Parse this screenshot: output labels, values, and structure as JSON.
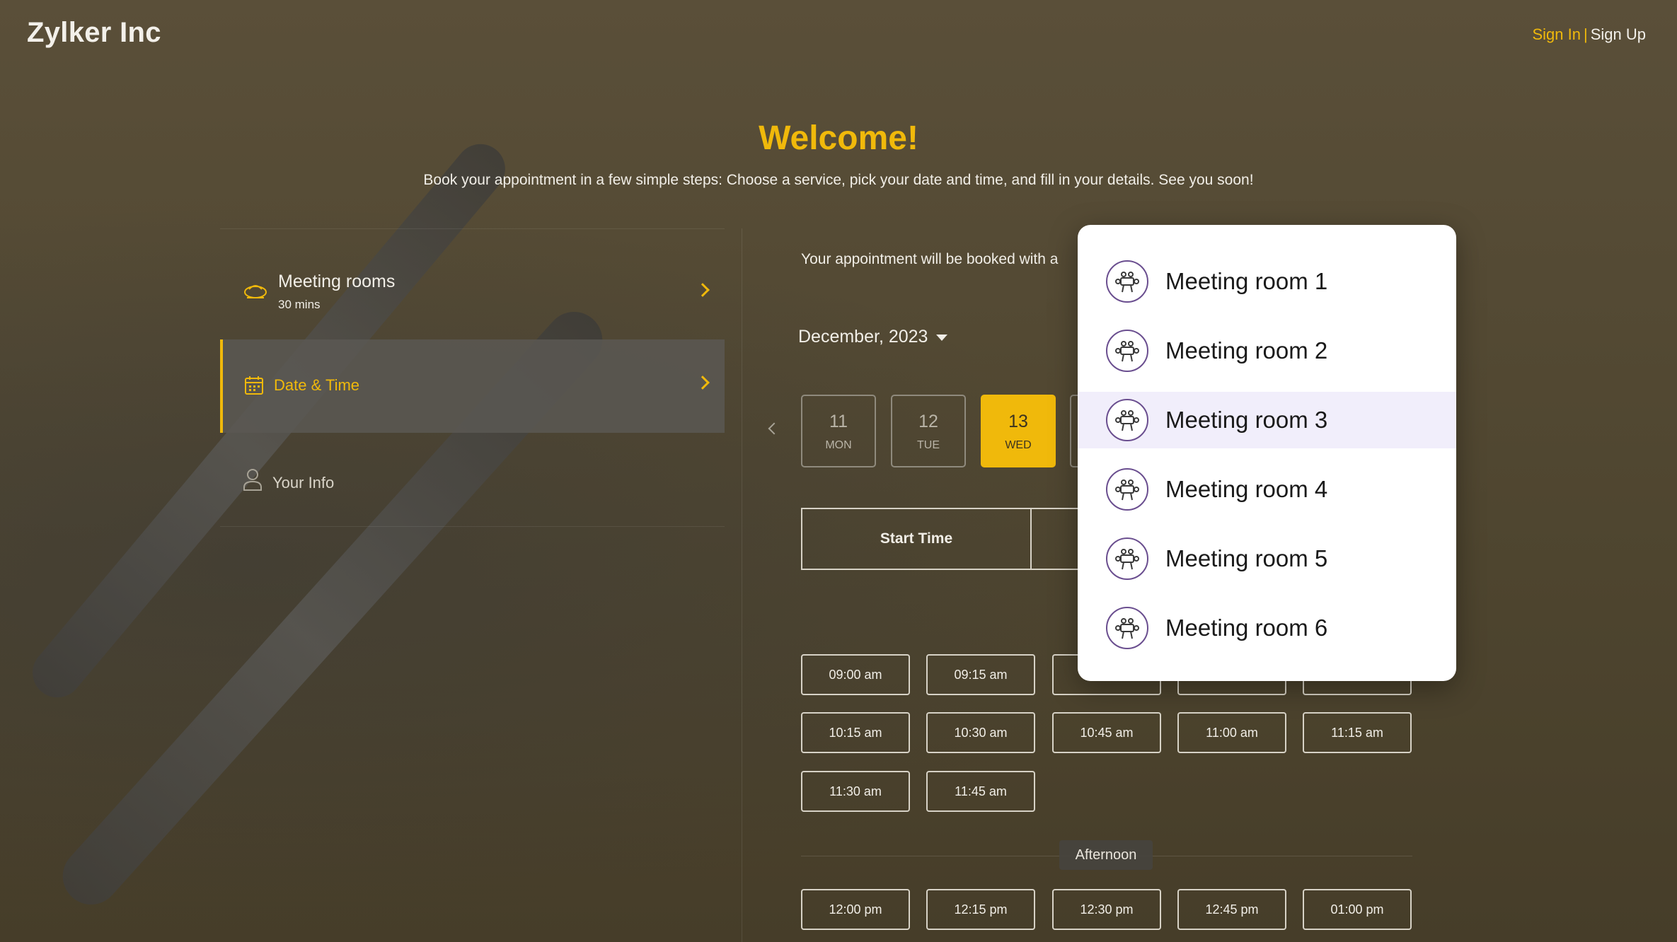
{
  "header": {
    "brand": "Zylker Inc",
    "sign_in": "Sign In",
    "separator": "|",
    "sign_up": "Sign Up"
  },
  "hero": {
    "title": "Welcome!",
    "subtitle": "Book your appointment in a few simple steps: Choose a service, pick your date and time, and fill in your details. See you soon!"
  },
  "steps": [
    {
      "title": "Meeting rooms",
      "sub": "30 mins",
      "icon": "meeting-room-icon"
    },
    {
      "title": "Date & Time",
      "icon": "calendar-icon",
      "active": true
    },
    {
      "title": "Your Info",
      "icon": "user-icon"
    }
  ],
  "booking": {
    "notice": "Your appointment will be booked with a",
    "month": "December, 2023",
    "days": [
      {
        "num": "11",
        "dow": "MON"
      },
      {
        "num": "12",
        "dow": "TUE"
      },
      {
        "num": "13",
        "dow": "WED",
        "selected": true
      }
    ],
    "start_time_label": "Start Time",
    "morning_slots": [
      [
        "09:00 am",
        "09:15 am",
        "",
        "",
        ""
      ],
      [
        "10:15 am",
        "10:30 am",
        "10:45 am",
        "11:00 am",
        "11:15 am"
      ],
      [
        "11:30 am",
        "11:45 am"
      ]
    ],
    "afternoon_label": "Afternoon",
    "afternoon_slots": [
      "12:00 pm",
      "12:15 pm",
      "12:30 pm",
      "12:45 pm",
      "01:00 pm"
    ]
  },
  "dropdown": {
    "items": [
      {
        "label": "Meeting room 1",
        "icon": "meeting-room-icon"
      },
      {
        "label": "Meeting room 2",
        "icon": "meeting-room-icon"
      },
      {
        "label": "Meeting room 3",
        "icon": "meeting-room-icon",
        "highlighted": true
      },
      {
        "label": "Meeting room 4",
        "icon": "meeting-room-icon"
      },
      {
        "label": "Meeting room 5",
        "icon": "meeting-room-icon"
      },
      {
        "label": "Meeting room 6",
        "icon": "meeting-room-icon"
      }
    ]
  },
  "colors": {
    "accent": "#f0b90b",
    "background": "#4e452f",
    "highlight": "#f1eefb"
  }
}
